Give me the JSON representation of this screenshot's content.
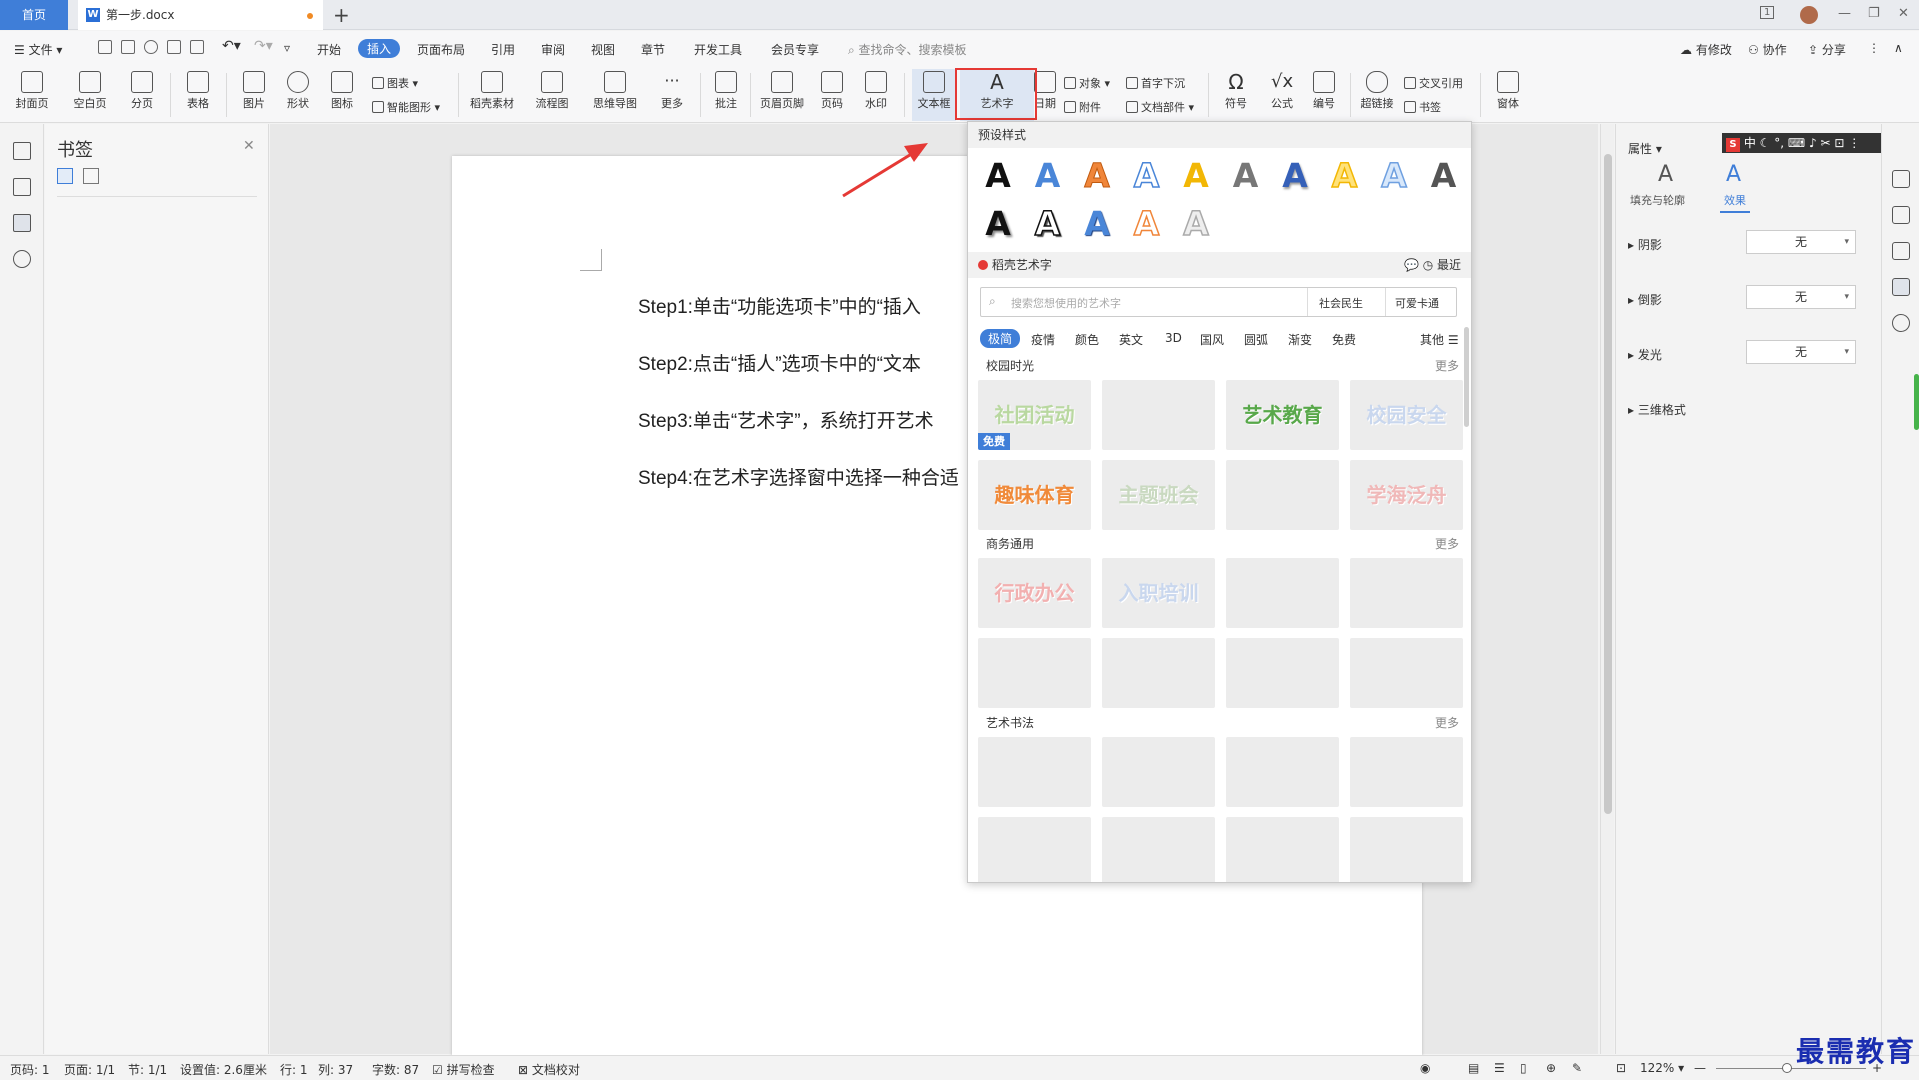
{
  "titlebar": {
    "home_tab": "首页",
    "doc_tab": "第一步.docx",
    "doc_icon": "W",
    "page_indicator": "1"
  },
  "menu": {
    "file": "文件",
    "tabs": [
      "开始",
      "插入",
      "页面布局",
      "引用",
      "审阅",
      "视图",
      "章节",
      "开发工具",
      "会员专享"
    ],
    "active_tab": "插入",
    "search_placeholder": "查找命令、搜索模板",
    "right": [
      "有修改",
      "协作",
      "分享"
    ]
  },
  "ribbon": {
    "buttons": [
      "封面页",
      "空白页",
      "分页",
      "表格",
      "图片",
      "形状",
      "图标",
      "稻壳素材",
      "流程图",
      "思维导图",
      "更多",
      "批注",
      "页眉页脚",
      "页码",
      "水印",
      "文本框",
      "艺术字",
      "日期",
      "符号",
      "公式",
      "编号",
      "超链接",
      "窗体"
    ],
    "small": {
      "chart": "图表",
      "smart": "智能图形",
      "object": "对象",
      "attach": "附件",
      "dropcap": "首字下沉",
      "docparts": "文档部件",
      "crossref": "交叉引用",
      "bookmark": "书签"
    }
  },
  "bookmark_pane": {
    "title": "书签"
  },
  "document": {
    "steps": [
      "Step1:单击“功能选项卡”中的“插入",
      "Step2:点击“插人”选项卡中的“文本",
      "Step3:单击“艺术字”，系统打开艺术",
      "Step4:在艺术字选择窗中选择一种合适"
    ]
  },
  "wordart": {
    "preset_title": "预设样式",
    "preset_glyph": "A",
    "daoke_title": "稻壳艺术字",
    "recent": "最近",
    "search_placeholder": "搜索您想使用的艺术字",
    "search_tags": [
      "社会民生",
      "可爱卡通"
    ],
    "categories": [
      "极简",
      "疫情",
      "颜色",
      "英文",
      "3D",
      "国风",
      "圆弧",
      "渐变",
      "免费"
    ],
    "active_category": "极简",
    "other": "其他",
    "more": "更多",
    "sections": [
      {
        "title": "校园时光",
        "tiles": [
          "社团活动",
          "",
          "艺术教育",
          "校园安全",
          "趣味体育",
          "主题班会",
          "",
          "学海泛舟"
        ]
      },
      {
        "title": "商务通用",
        "tiles": [
          "行政办公",
          "入职培训",
          "",
          "",
          "",
          "",
          "",
          ""
        ]
      },
      {
        "title": "艺术书法",
        "tiles": [
          "",
          "",
          "",
          "",
          "",
          "",
          "",
          ""
        ]
      }
    ],
    "free_badge": "免费"
  },
  "props": {
    "header": "属性",
    "tab_fill": "填充与轮廓",
    "tab_effect": "效果",
    "rows": [
      {
        "label": "阴影",
        "value": "无"
      },
      {
        "label": "倒影",
        "value": "无"
      },
      {
        "label": "发光",
        "value": "无"
      },
      {
        "label": "三维格式",
        "value": ""
      }
    ]
  },
  "ime": {
    "label": "中"
  },
  "status": {
    "items": [
      "页码: 1",
      "页面: 1/1",
      "节: 1/1",
      "设置值: 2.6厘米",
      "行: 1",
      "列: 37",
      "字数: 87",
      "拼写检查",
      "文档校对"
    ],
    "zoom": "122%"
  },
  "watermark": "最需教育",
  "colors": {
    "accent": "#3f7ed8",
    "highlight": "#e53935"
  }
}
